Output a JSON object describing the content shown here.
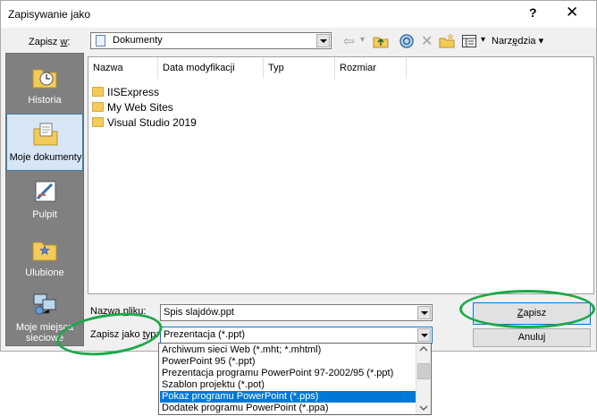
{
  "window": {
    "title": "Zapisywanie jako",
    "help": "?",
    "close": "✕"
  },
  "toolbar": {
    "save_in_label_pre": "Zapisz ",
    "save_in_label_key": "w",
    "save_in_label_post": ":",
    "location": "Dokumenty",
    "tools_label_pre": "Narz",
    "tools_label_key": "ę",
    "tools_label_post": "dzia",
    "tools_arrow": "▾",
    "back": "⇦",
    "back_arrow": "▾",
    "delete": "✕"
  },
  "places": [
    {
      "label": "Historia"
    },
    {
      "label": "Moje dokumenty"
    },
    {
      "label": "Pulpit"
    },
    {
      "label": "Ulubione"
    },
    {
      "label": "Moje miejsca sieciowe"
    }
  ],
  "columns": [
    "Nazwa",
    "Data modyfikacji",
    "Typ",
    "Rozmiar"
  ],
  "files": [
    "IISExpress",
    "My Web Sites",
    "Visual Studio 2019"
  ],
  "filename": {
    "label_pre": "Nazwa ",
    "label_key": "p",
    "label_post": "liku:",
    "value": "Spis slajdów.ppt"
  },
  "filetype": {
    "label_pre": "Zapisz jako ",
    "label_key": "t",
    "label_post": "yp:",
    "value": "Prezentacja (*.ppt)",
    "options": [
      "Archiwum sieci Web (*.mht; *.mhtml)",
      "PowerPoint 95 (*.ppt)",
      "Prezentacja programu PowerPoint 97-2002/95 (*.ppt)",
      "Szablon projektu (*.pot)",
      "Pokaz programu PowerPoint (*.pps)",
      "Dodatek programu PowerPoint (*.ppa)"
    ],
    "selected_index": 4
  },
  "buttons": {
    "save_key": "Z",
    "save_rest": "apisz",
    "cancel": "Anuluj"
  },
  "colors": {
    "accent": "#0078d7",
    "annotation": "#1ea84b",
    "folder": "#f2cb5a"
  }
}
